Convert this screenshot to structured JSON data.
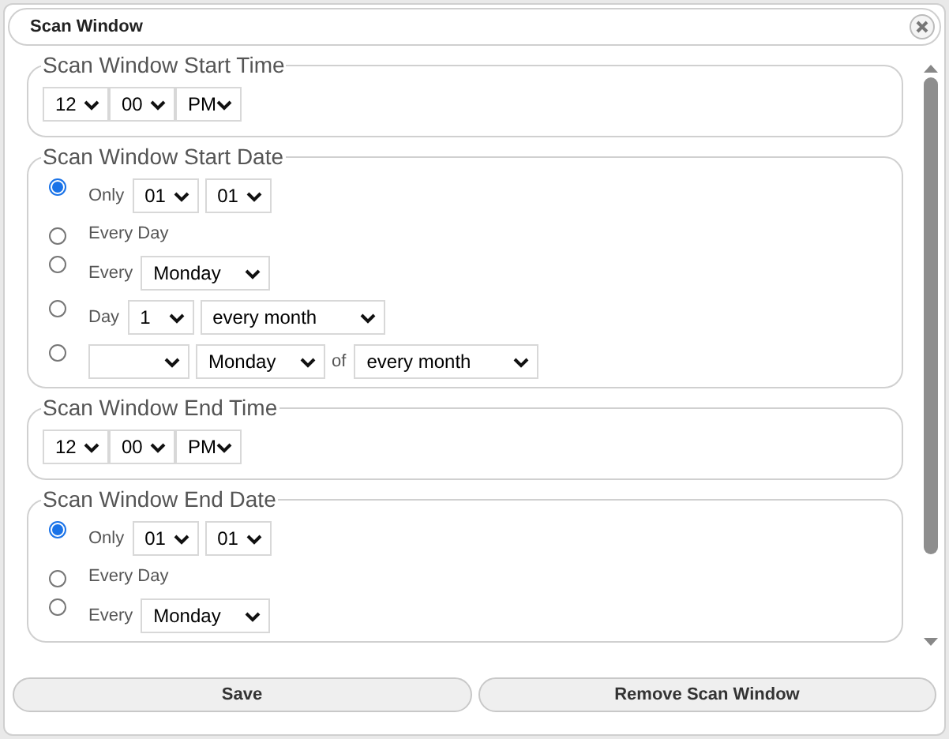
{
  "window": {
    "title": "Scan Window"
  },
  "sections": [
    {
      "kind": "time",
      "title": "Scan Window Start Time",
      "selects": [
        "12",
        "00",
        "PM"
      ]
    },
    {
      "kind": "date",
      "title": "Scan Window Start Date",
      "options": [
        {
          "selected": true,
          "parts": [
            {
              "kind": "label",
              "text": "Only"
            },
            {
              "kind": "select",
              "value": "01"
            },
            {
              "kind": "select",
              "value": "01"
            }
          ]
        },
        {
          "selected": false,
          "parts": [
            {
              "kind": "label",
              "text": "Every Day"
            }
          ]
        },
        {
          "selected": false,
          "parts": [
            {
              "kind": "label",
              "text": "Every"
            },
            {
              "kind": "select",
              "value": "Monday"
            }
          ]
        },
        {
          "selected": false,
          "parts": [
            {
              "kind": "label",
              "text": "Day"
            },
            {
              "kind": "select",
              "value": "1"
            },
            {
              "kind": "select",
              "value": "every month"
            }
          ]
        },
        {
          "selected": false,
          "parts": [
            {
              "kind": "select"
            },
            {
              "kind": "select",
              "value": "Monday"
            },
            {
              "kind": "label",
              "text": "of"
            },
            {
              "kind": "select",
              "value": "every month"
            }
          ]
        }
      ]
    },
    {
      "kind": "time",
      "title": "Scan Window End Time",
      "selects": [
        "12",
        "00",
        "PM"
      ]
    },
    {
      "kind": "date",
      "title": "Scan Window End Date",
      "options": [
        {
          "selected": true,
          "parts": [
            {
              "kind": "label",
              "text": "Only"
            },
            {
              "kind": "select",
              "value": "01"
            },
            {
              "kind": "select",
              "value": "01"
            }
          ]
        },
        {
          "selected": false,
          "parts": [
            {
              "kind": "label",
              "text": "Every Day"
            }
          ]
        },
        {
          "selected": false,
          "parts": [
            {
              "kind": "label",
              "text": "Every"
            },
            {
              "kind": "select",
              "value": "Monday"
            }
          ]
        }
      ]
    }
  ],
  "buttons": [
    "Save",
    "Remove Scan Window"
  ]
}
